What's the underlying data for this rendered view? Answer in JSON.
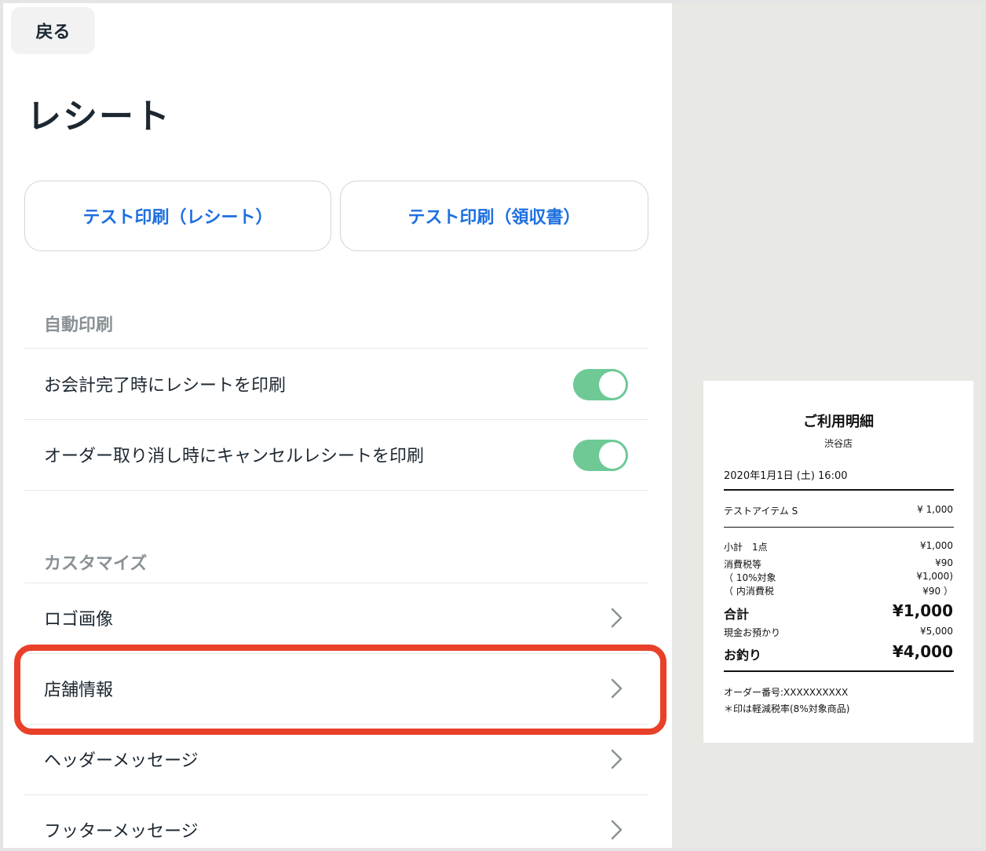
{
  "nav": {
    "back_label": "戻る"
  },
  "page": {
    "title": "レシート"
  },
  "test_buttons": {
    "receipt_label": "テスト印刷（レシート）",
    "invoice_label": "テスト印刷（領収書）"
  },
  "auto_print": {
    "header": "自動印刷",
    "items": [
      {
        "label": "お会計完了時にレシートを印刷",
        "enabled": true
      },
      {
        "label": "オーダー取り消し時にキャンセルレシートを印刷",
        "enabled": true
      }
    ]
  },
  "customize": {
    "header": "カスタマイズ",
    "items": [
      {
        "label": "ロゴ画像"
      },
      {
        "label": "店舗情報"
      },
      {
        "label": "ヘッダーメッセージ"
      },
      {
        "label": "フッターメッセージ"
      }
    ]
  },
  "colors": {
    "accent": "#1d6fe0",
    "toggle_on": "#6ec995",
    "highlight": "#e9402a"
  },
  "receipt_preview": {
    "title": "ご利用明細",
    "shop": "渋谷店",
    "datetime": "2020年1月1日 (土) 16:00",
    "item_name": "テストアイテム S",
    "item_price": "¥ 1,000",
    "subtotal_label": "小計　1点",
    "subtotal_value": "¥1,000",
    "tax_label": "消費税等",
    "tax_value": "¥90",
    "tax_target_label": "（ 10%対象",
    "tax_target_value": "¥1,000)",
    "tax_inner_label": "（ 内消費税",
    "tax_inner_value": "¥90 ）",
    "total_label": "合計",
    "total_value": "¥1,000",
    "cash_label": "現金お預かり",
    "cash_value": "¥5,000",
    "change_label": "お釣り",
    "change_value": "¥4,000",
    "order_no": "オーダー番号:XXXXXXXXXX",
    "note": "＊印は軽減税率(8%対象商品)"
  }
}
